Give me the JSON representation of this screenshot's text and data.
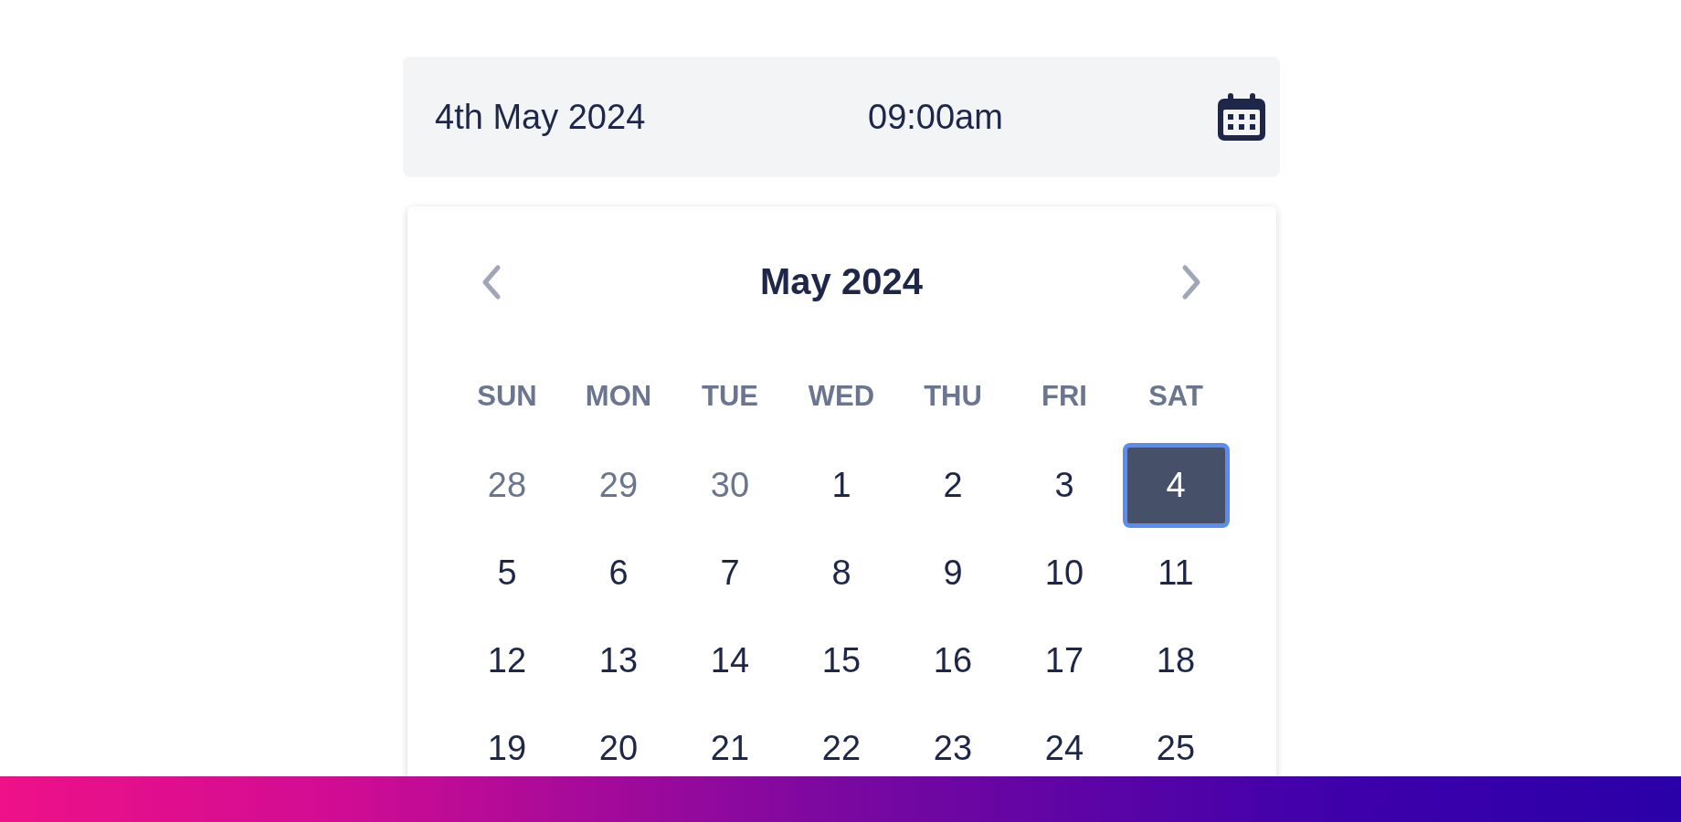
{
  "field": {
    "date": "4th May 2024",
    "time": "09:00am"
  },
  "calendar": {
    "month": "May 2024",
    "weekdays": [
      "SUN",
      "MON",
      "TUE",
      "WED",
      "THU",
      "FRI",
      "SAT"
    ],
    "days": [
      {
        "label": "28",
        "outside": true,
        "selected": false
      },
      {
        "label": "29",
        "outside": true,
        "selected": false
      },
      {
        "label": "30",
        "outside": true,
        "selected": false
      },
      {
        "label": "1",
        "outside": false,
        "selected": false
      },
      {
        "label": "2",
        "outside": false,
        "selected": false
      },
      {
        "label": "3",
        "outside": false,
        "selected": false
      },
      {
        "label": "4",
        "outside": false,
        "selected": true
      },
      {
        "label": "5",
        "outside": false,
        "selected": false
      },
      {
        "label": "6",
        "outside": false,
        "selected": false
      },
      {
        "label": "7",
        "outside": false,
        "selected": false
      },
      {
        "label": "8",
        "outside": false,
        "selected": false
      },
      {
        "label": "9",
        "outside": false,
        "selected": false
      },
      {
        "label": "10",
        "outside": false,
        "selected": false
      },
      {
        "label": "11",
        "outside": false,
        "selected": false
      },
      {
        "label": "12",
        "outside": false,
        "selected": false
      },
      {
        "label": "13",
        "outside": false,
        "selected": false
      },
      {
        "label": "14",
        "outside": false,
        "selected": false
      },
      {
        "label": "15",
        "outside": false,
        "selected": false
      },
      {
        "label": "16",
        "outside": false,
        "selected": false
      },
      {
        "label": "17",
        "outside": false,
        "selected": false
      },
      {
        "label": "18",
        "outside": false,
        "selected": false
      },
      {
        "label": "19",
        "outside": false,
        "selected": false
      },
      {
        "label": "20",
        "outside": false,
        "selected": false
      },
      {
        "label": "21",
        "outside": false,
        "selected": false
      },
      {
        "label": "22",
        "outside": false,
        "selected": false
      },
      {
        "label": "23",
        "outside": false,
        "selected": false
      },
      {
        "label": "24",
        "outside": false,
        "selected": false
      },
      {
        "label": "25",
        "outside": false,
        "selected": false
      }
    ]
  }
}
